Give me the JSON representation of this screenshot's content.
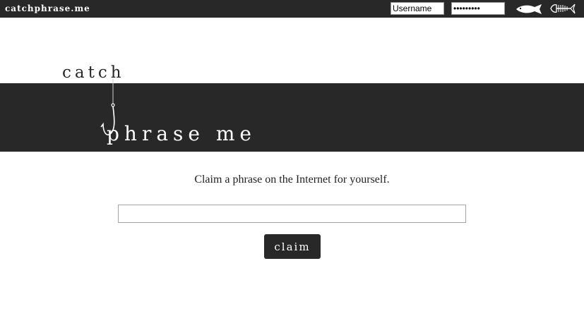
{
  "topbar": {
    "brand": "catchphrase.me",
    "username_value": "Username",
    "password_value": "•••••••••",
    "icons": [
      "fish-icon",
      "fish-bones-icon"
    ]
  },
  "logo": {
    "catch": "catch",
    "phrase_me": "phrase me"
  },
  "main": {
    "tagline": "Claim a phrase on the Internet for yourself.",
    "phrase_value": "",
    "claim_label": "claim"
  },
  "colors": {
    "dark": "#282828",
    "background": "#ffffff",
    "text": "#222222"
  }
}
